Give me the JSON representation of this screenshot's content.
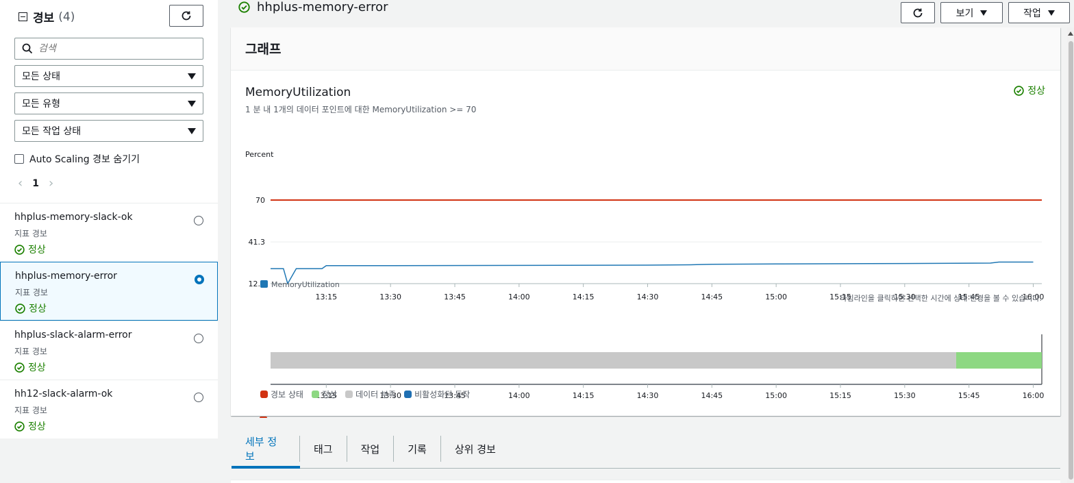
{
  "sidebar": {
    "title": "경보",
    "count": "(4)",
    "search_placeholder": "검색",
    "filters": [
      "모든 상태",
      "모든 유형",
      "모든 작업 상태"
    ],
    "hide_autoscaling_label": "Auto Scaling 경보 숨기기",
    "page": "1",
    "alarms": [
      {
        "name": "hhplus-memory-slack-ok",
        "type": "지표 경보",
        "status": "정상",
        "selected": false
      },
      {
        "name": "hhplus-memory-error",
        "type": "지표 경보",
        "status": "정상",
        "selected": true
      },
      {
        "name": "hhplus-slack-alarm-error",
        "type": "지표 경보",
        "status": "정상",
        "selected": false
      },
      {
        "name": "hh12-slack-alarm-ok",
        "type": "지표 경보",
        "status": "정상",
        "selected": false
      }
    ]
  },
  "header": {
    "alarm_name": "hhplus-memory-error",
    "view_label": "보기",
    "actions_label": "작업"
  },
  "graph_card": {
    "title": "그래프",
    "metric_title": "MemoryUtilization",
    "metric_subtitle": "1 분 내 1개의 데이터 포인트에 대한 MemoryUtilization >= 70",
    "status": "정상",
    "timeline_hint": "타임라인을 클릭하면 선택한 시간에 상태 변경을 볼 수 있습니다.",
    "state_legend": [
      "경보 상태",
      "정상",
      "데이터 부족",
      "비활성화된 동작"
    ]
  },
  "tabs": [
    "세부 정보",
    "태그",
    "작업",
    "기록",
    "상위 경보"
  ],
  "colors": {
    "ok": "#1d8102",
    "threshold": "#d13212",
    "series": "#1f77b4",
    "alarm_state": "#d13212",
    "ok_state": "#8dd882",
    "insufficient": "#c8c8c8",
    "disabled": "#1f6fb2",
    "accent": "#0073bb"
  },
  "chart_data": {
    "type": "line",
    "ylabel": "Percent",
    "y_ticks": [
      12.7,
      41.3,
      70
    ],
    "ylim": [
      12.7,
      70
    ],
    "x_ticks": [
      "13:15",
      "13:30",
      "13:45",
      "14:00",
      "14:15",
      "14:30",
      "14:45",
      "15:00",
      "15:15",
      "15:30",
      "15:45",
      "16:00"
    ],
    "threshold": 70,
    "series": [
      {
        "name": "MemoryUtilization",
        "x": [
          "13:02",
          "13:05",
          "13:06",
          "13:08",
          "13:14",
          "13:15",
          "13:30",
          "14:00",
          "14:30",
          "14:40",
          "14:45",
          "15:00",
          "15:30",
          "15:50",
          "15:52",
          "16:00"
        ],
        "y": [
          23.0,
          23.0,
          12.7,
          23.0,
          23.0,
          25.0,
          25.0,
          25.2,
          25.4,
          25.6,
          26.0,
          26.2,
          26.5,
          26.8,
          27.5,
          27.5
        ]
      }
    ],
    "timeline": {
      "type": "state",
      "x_ticks": [
        "13:15",
        "13:30",
        "13:45",
        "14:00",
        "14:15",
        "14:30",
        "14:45",
        "15:00",
        "15:15",
        "15:30",
        "15:45",
        "16:00"
      ],
      "segments": [
        {
          "state": "데이터 부족",
          "from": "13:02",
          "to": "15:42"
        },
        {
          "state": "정상",
          "from": "15:42",
          "to": "16:02"
        }
      ]
    }
  }
}
